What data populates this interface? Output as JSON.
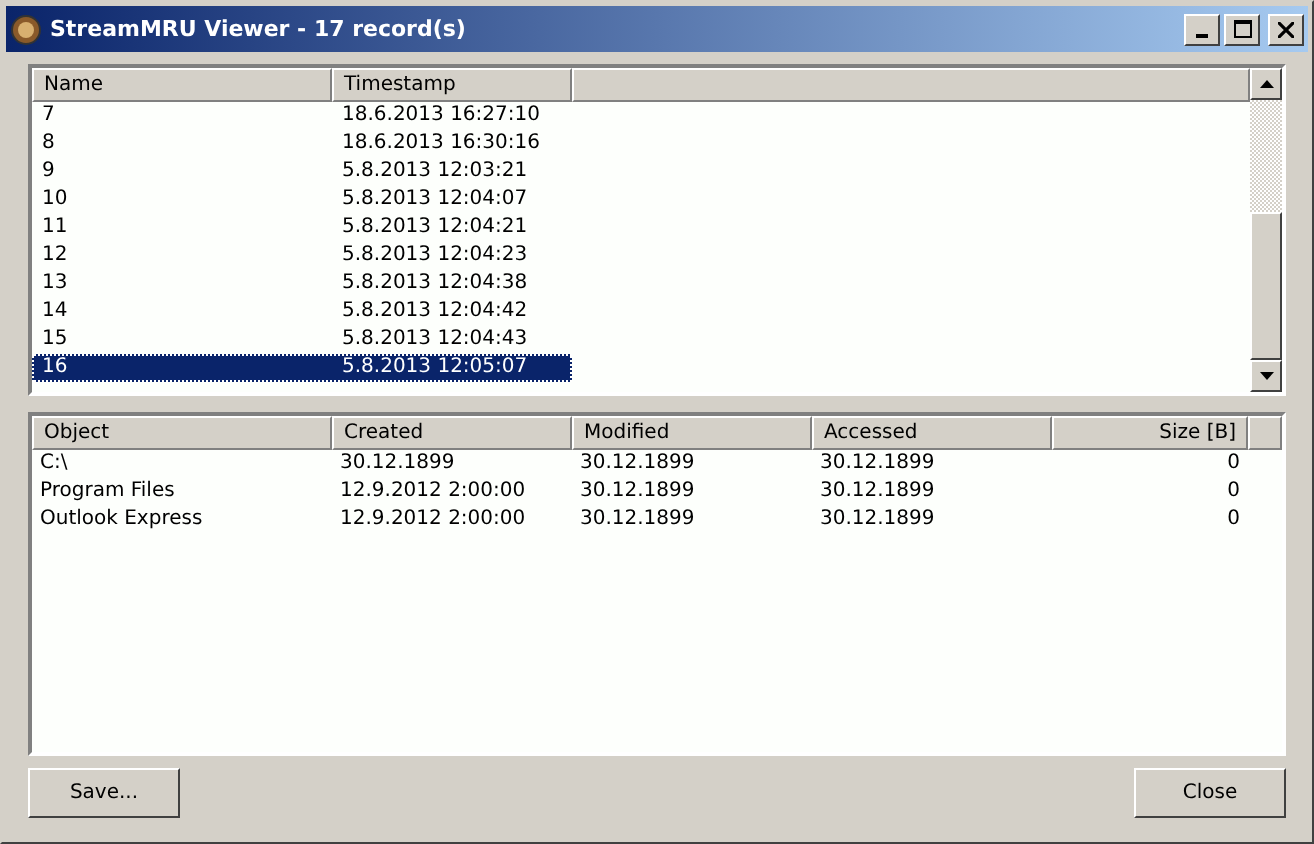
{
  "window": {
    "title": "StreamMRU Viewer - 17 record(s)"
  },
  "records": {
    "columns": [
      "Name",
      "Timestamp"
    ],
    "rows": [
      {
        "cells": [
          "7",
          "18.6.2013 16:27:10"
        ],
        "selected": false
      },
      {
        "cells": [
          "8",
          "18.6.2013 16:30:16"
        ],
        "selected": false
      },
      {
        "cells": [
          "9",
          "5.8.2013 12:03:21"
        ],
        "selected": false
      },
      {
        "cells": [
          "10",
          "5.8.2013 12:04:07"
        ],
        "selected": false
      },
      {
        "cells": [
          "11",
          "5.8.2013 12:04:21"
        ],
        "selected": false
      },
      {
        "cells": [
          "12",
          "5.8.2013 12:04:23"
        ],
        "selected": false
      },
      {
        "cells": [
          "13",
          "5.8.2013 12:04:38"
        ],
        "selected": false
      },
      {
        "cells": [
          "14",
          "5.8.2013 12:04:42"
        ],
        "selected": false
      },
      {
        "cells": [
          "15",
          "5.8.2013 12:04:43"
        ],
        "selected": false
      },
      {
        "cells": [
          "16",
          "5.8.2013 12:05:07"
        ],
        "selected": true
      }
    ]
  },
  "objects": {
    "columns": [
      "Object",
      "Created",
      "Modified",
      "Accessed",
      "Size [B]"
    ],
    "rows": [
      {
        "cells": [
          "C:\\",
          "30.12.1899",
          "30.12.1899",
          "30.12.1899",
          "0"
        ]
      },
      {
        "cells": [
          "Program Files",
          "12.9.2012 2:00:00",
          "30.12.1899",
          "30.12.1899",
          "0"
        ]
      },
      {
        "cells": [
          "Outlook Express",
          "12.9.2012 2:00:00",
          "30.12.1899",
          "30.12.1899",
          "0"
        ]
      }
    ]
  },
  "buttons": [
    "Save...",
    "Close"
  ]
}
